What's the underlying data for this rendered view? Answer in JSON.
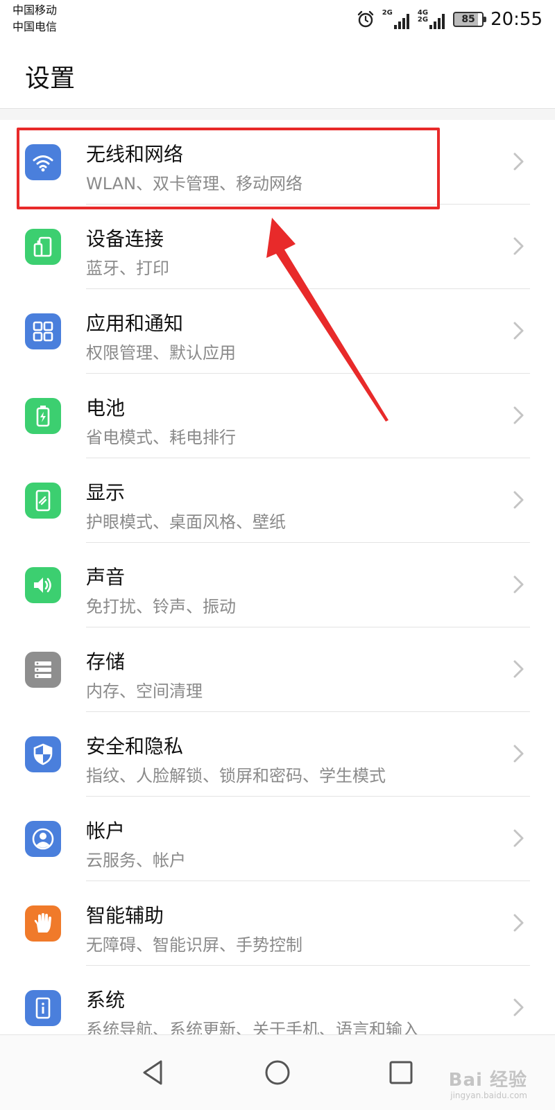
{
  "status_bar": {
    "carrier_1": "中国移动",
    "carrier_2": "中国电信",
    "sig1_label": "2G",
    "sig2_label_top": "4G",
    "sig2_label_bottom": "2G",
    "battery_level": "85",
    "time": "20:55",
    "icons": [
      "alarm-icon",
      "signal-2g-icon",
      "signal-4g-2g-icon",
      "battery-icon"
    ]
  },
  "header": {
    "title": "设置"
  },
  "settings": [
    {
      "title": "无线和网络",
      "subtitle": "WLAN、双卡管理、移动网络",
      "icon": "wifi-icon",
      "color": "#4a7fdc"
    },
    {
      "title": "设备连接",
      "subtitle": "蓝牙、打印",
      "icon": "device-connect-icon",
      "color": "#3ccf70"
    },
    {
      "title": "应用和通知",
      "subtitle": "权限管理、默认应用",
      "icon": "apps-grid-icon",
      "color": "#4a7fdc"
    },
    {
      "title": "电池",
      "subtitle": "省电模式、耗电排行",
      "icon": "battery-icon",
      "color": "#3ccf70"
    },
    {
      "title": "显示",
      "subtitle": "护眼模式、桌面风格、壁纸",
      "icon": "display-icon",
      "color": "#3ccf70"
    },
    {
      "title": "声音",
      "subtitle": "免打扰、铃声、振动",
      "icon": "speaker-icon",
      "color": "#3ccf70"
    },
    {
      "title": "存储",
      "subtitle": "内存、空间清理",
      "icon": "storage-icon",
      "color": "#8e8e8e"
    },
    {
      "title": "安全和隐私",
      "subtitle": "指纹、人脸解锁、锁屏和密码、学生模式",
      "icon": "shield-icon",
      "color": "#4a7fdc"
    },
    {
      "title": "帐户",
      "subtitle": "云服务、帐户",
      "icon": "account-icon",
      "color": "#4a7fdc"
    },
    {
      "title": "智能辅助",
      "subtitle": "无障碍、智能识屏、手势控制",
      "icon": "hand-icon",
      "color": "#f07a2a"
    },
    {
      "title": "系统",
      "subtitle": "系统导航、系统更新、关于手机、语言和输入",
      "icon": "system-info-icon",
      "color": "#4a7fdc"
    }
  ],
  "annotation": {
    "highlight_color": "#e82a2a",
    "arrow_color": "#e82a2a"
  },
  "nav_bar": {
    "icons": [
      "back-triangle-icon",
      "home-circle-icon",
      "recent-square-icon"
    ],
    "watermark": "Bai 经验",
    "watermark_url": "jingyan.baidu.com"
  }
}
